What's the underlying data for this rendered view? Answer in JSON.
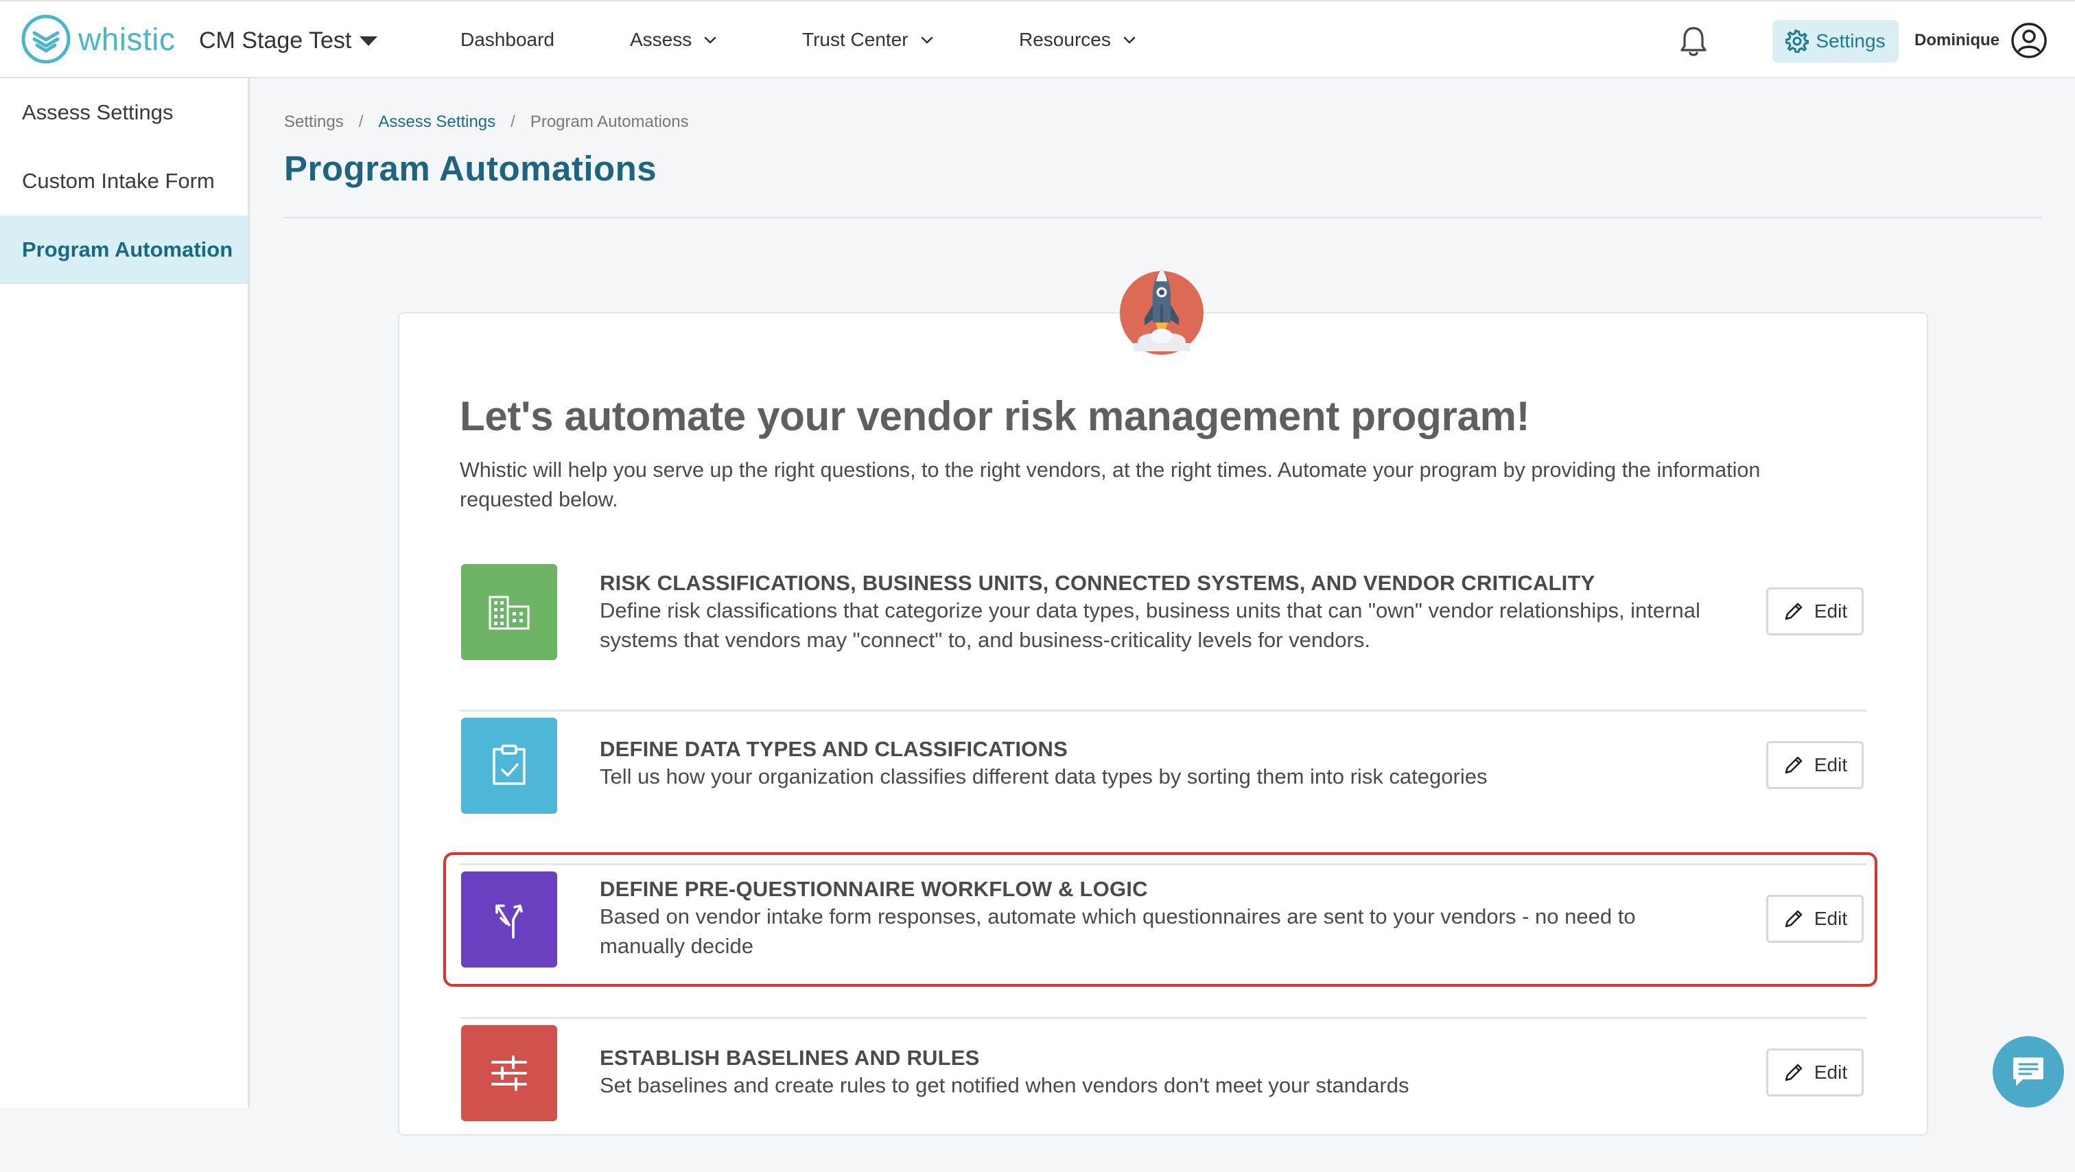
{
  "header": {
    "brand": "whistic",
    "org_name": "CM Stage Test",
    "nav": {
      "dashboard": "Dashboard",
      "assess": "Assess",
      "trust_center": "Trust Center",
      "resources": "Resources"
    },
    "settings_label": "Settings",
    "user_name": "Dominique"
  },
  "sidebar": {
    "items": [
      {
        "label": "Assess Settings",
        "active": false
      },
      {
        "label": "Custom Intake Form",
        "active": false
      },
      {
        "label": "Program Automation",
        "active": true
      }
    ]
  },
  "breadcrumb": {
    "root": "Settings",
    "middle": "Assess Settings",
    "current": "Program Automations",
    "separator": "/"
  },
  "page_title": "Program Automations",
  "hero": {
    "title": "Let's automate your vendor risk management program!",
    "subtitle": "Whistic will help you serve up the right questions, to the right vendors, at the right times. Automate your program by providing the information requested below."
  },
  "automation_items": [
    {
      "heading": "RISK CLASSIFICATIONS, BUSINESS UNITS, CONNECTED SYSTEMS, AND VENDOR CRITICALITY",
      "description": "Define risk classifications that categorize your data types, business units that can \"own\" vendor relationships, internal systems that vendors may \"connect\" to, and business-criticality levels for vendors.",
      "icon": "building-icon",
      "color": "#6db466",
      "edit_label": "Edit"
    },
    {
      "heading": "DEFINE DATA TYPES AND CLASSIFICATIONS",
      "description": "Tell us how your organization classifies different data types by sorting them into risk categories",
      "icon": "clipboard-check-icon",
      "color": "#4eb6d6",
      "edit_label": "Edit"
    },
    {
      "heading": "DEFINE PRE-QUESTIONNAIRE WORKFLOW & LOGIC",
      "description": "Based on vendor intake form responses, automate which questionnaires are sent to your vendors - no need to manually decide",
      "icon": "branch-arrows-icon",
      "color": "#6a3fc0",
      "edit_label": "Edit"
    },
    {
      "heading": "ESTABLISH BASELINES AND RULES",
      "description": "Set baselines and create rules to get notified when vendors don't meet your standards",
      "icon": "sliders-icon",
      "color": "#d1524c",
      "edit_label": "Edit"
    }
  ],
  "colors": {
    "brand": "#4ab6c9",
    "title": "#1c6480",
    "highlight": "#e0322b",
    "chat": "#4aaac8"
  }
}
